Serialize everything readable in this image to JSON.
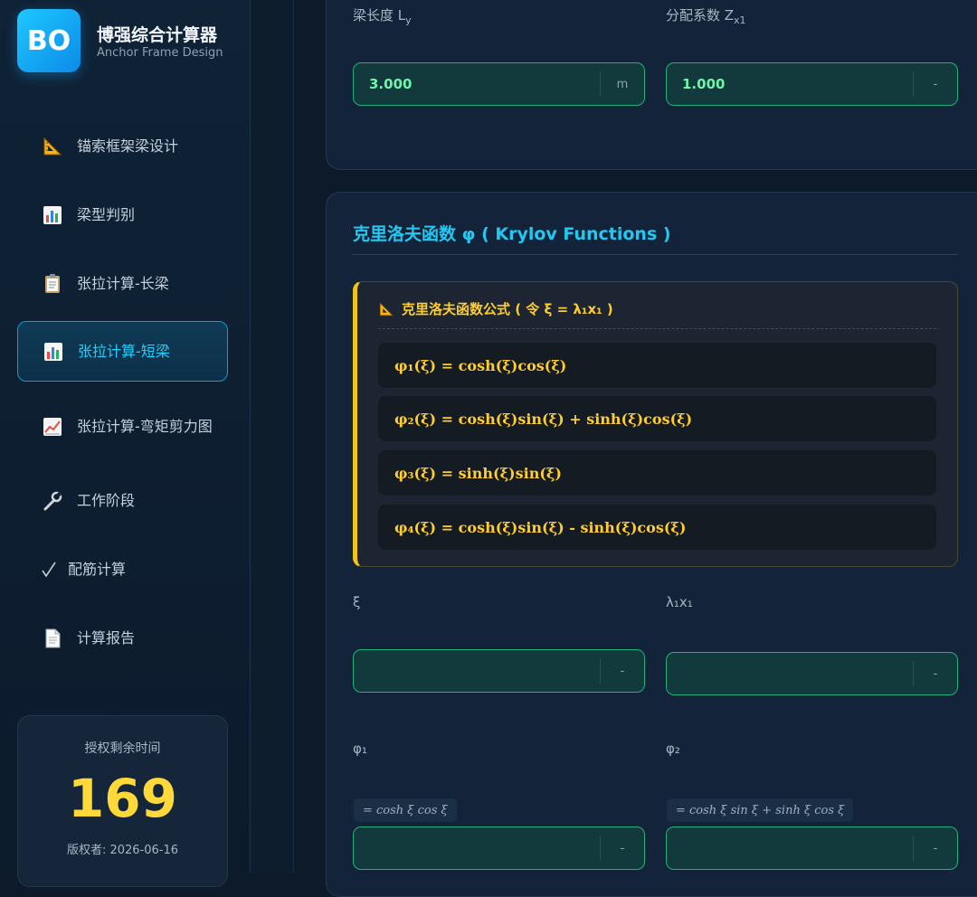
{
  "app": {
    "logo_text": "BO",
    "title": "博强综合计算器",
    "subtitle": "Anchor Frame Design"
  },
  "sidebar": {
    "items": [
      {
        "label": "锚索框架梁设计",
        "icon": "triangle-ruler-icon"
      },
      {
        "label": "梁型判别",
        "icon": "bar-chart-icon"
      },
      {
        "label": "张拉计算-长梁",
        "icon": "clipboard-icon"
      },
      {
        "label": "张拉计算-短梁",
        "icon": "bar-chart-icon",
        "active": true
      },
      {
        "label": "张拉计算-弯矩剪力图",
        "icon": "line-chart-icon"
      },
      {
        "label": "工作阶段",
        "icon": "wrench-icon"
      },
      {
        "label": "配筋计算",
        "icon": "check-icon"
      },
      {
        "label": "计算报告",
        "icon": "document-icon"
      }
    ]
  },
  "license": {
    "label": "授权剩余时间",
    "days": "169",
    "copyright": "版权者: 2026-06-16"
  },
  "top_card": {
    "beam_length": {
      "label": "梁长度 L",
      "sub": "y",
      "value": "3.000",
      "unit": "m"
    },
    "distribution": {
      "label": "分配系数 Z",
      "sub": "x1",
      "value": "1.000",
      "unit": "-"
    }
  },
  "krylov": {
    "title": "克里洛夫函数 φ ( Krylov Functions )",
    "formula_heading": "克里洛夫函数公式 ( 令 ξ = λ₁x₁ )",
    "formulas": [
      "φ₁(ξ) = cosh(ξ)cos(ξ)",
      "φ₂(ξ) = cosh(ξ)sin(ξ) + sinh(ξ)cos(ξ)",
      "φ₃(ξ) = sinh(ξ)sin(ξ)",
      "φ₄(ξ) = cosh(ξ)sin(ξ) - sinh(ξ)cos(ξ)"
    ],
    "fields": {
      "xi": {
        "label": "ξ",
        "value": "",
        "unit": "-"
      },
      "lambda_x": {
        "label": "λ₁x₁",
        "value": "",
        "unit": "-"
      },
      "phi1": {
        "label": "φ₁",
        "hint": "= cosh ξ cos ξ",
        "value": "",
        "unit": "-"
      },
      "phi2": {
        "label": "φ₂",
        "hint": "= cosh ξ sin ξ + sinh ξ cos ξ",
        "value": "",
        "unit": "-"
      }
    }
  },
  "colors": {
    "accent": "#1fd0ff",
    "formula": "#ffce2e",
    "input_value": "#6ff5a9",
    "license_days": "#ffd93a"
  }
}
